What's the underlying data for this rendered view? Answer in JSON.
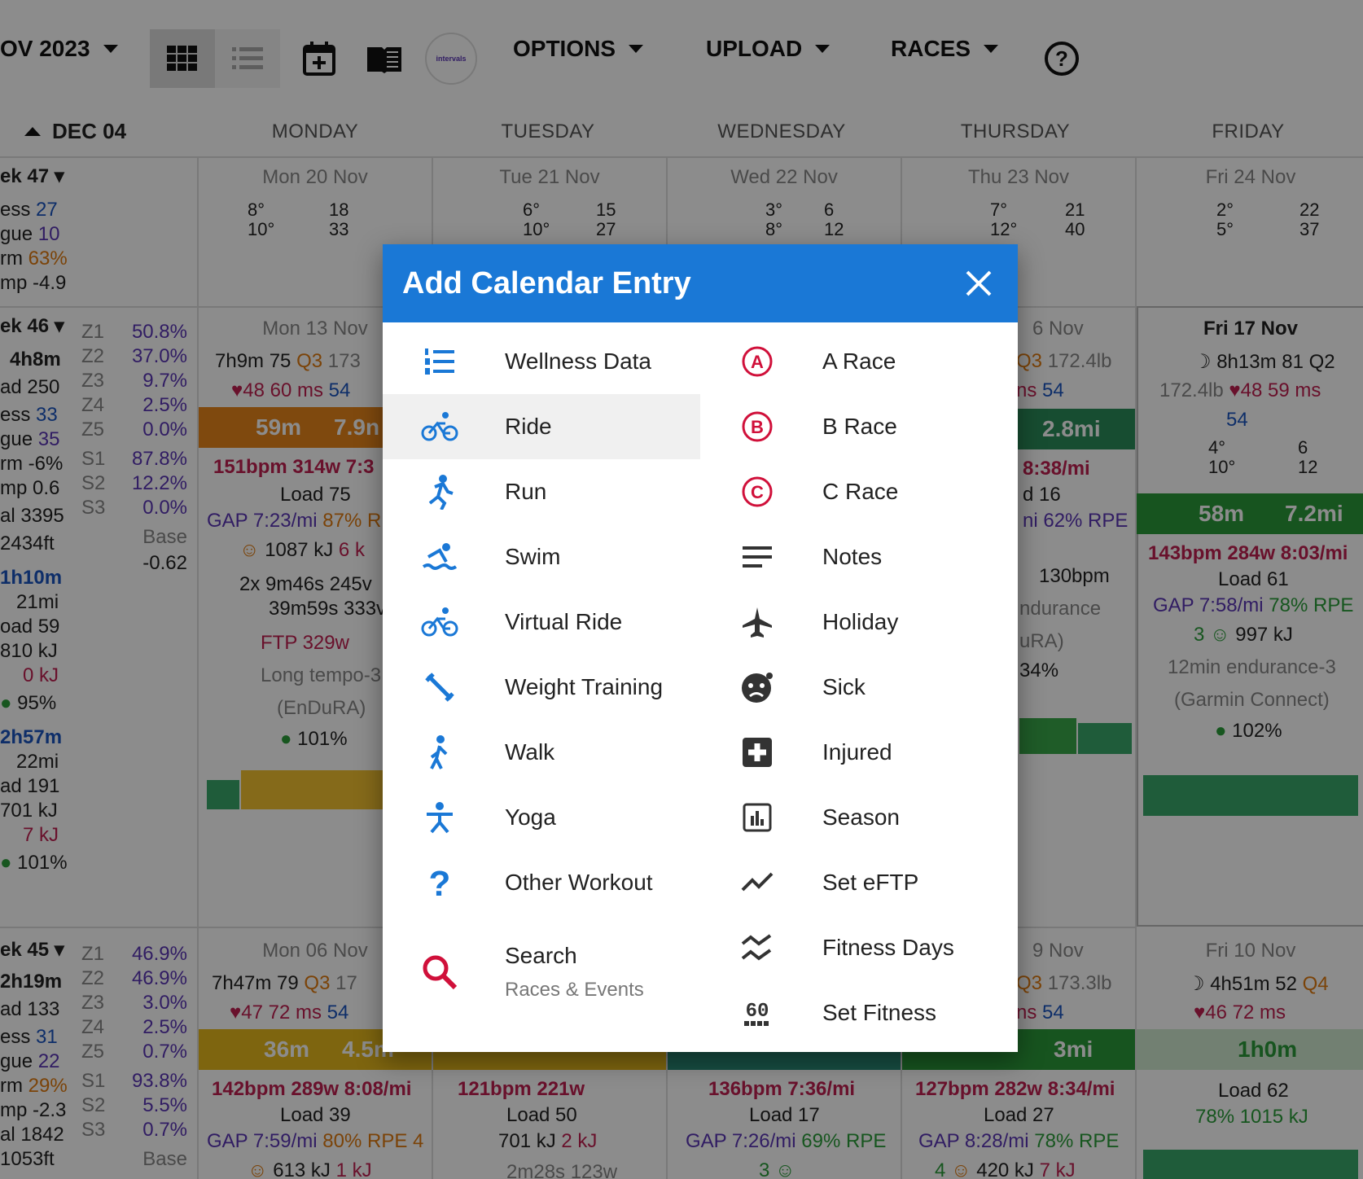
{
  "toolbar": {
    "month": "OV 2023",
    "options": "OPTIONS",
    "upload": "UPLOAD",
    "races": "RACES",
    "logo": "intervals"
  },
  "header": {
    "week_nav": "DEC 04",
    "days": [
      "MONDAY",
      "TUESDAY",
      "WEDNESDAY",
      "THURSDAY",
      "FRIDAY"
    ]
  },
  "left": {
    "w47": {
      "label": "ek 47",
      "fitness": "ess",
      "fitness_v": "27",
      "fatigue": "gue",
      "fatigue_v": "10",
      "form": "rm",
      "form_v": "63%",
      "ramp": "mp -4.9"
    },
    "w46": {
      "label": "ek 46",
      "time": "4h8m",
      "load": "ad 250",
      "fitness": "ess",
      "fitness_v": "33",
      "fatigue": "gue",
      "fatigue_v": "35",
      "form": "rm -6%",
      "ramp": "mp 0.6",
      "cal": "al 3395",
      "elev": "2434ft",
      "t1": "1h10m",
      "d1": "21mi",
      "l1": "oad 59",
      "k1": "810 kJ",
      "k1b": "0 kJ",
      "c1": "95%",
      "t2": "2h57m",
      "d2": "22mi",
      "l2": "ad 191",
      "k2": "701 kJ",
      "k2b": "7 kJ",
      "c2": "101%",
      "zones": [
        "Z1",
        "Z2",
        "Z3",
        "Z4",
        "Z5",
        "S1",
        "S2",
        "S3"
      ],
      "zone_vals": [
        "50.8%",
        "37.0%",
        "9.7%",
        "2.5%",
        "0.0%",
        "87.8%",
        "12.2%",
        "0.0%"
      ],
      "base": "Base",
      "base_v": "-0.62"
    },
    "w45": {
      "label": "ek 45",
      "time": "2h19m",
      "load": "ad 133",
      "fitness": "ess",
      "fitness_v": "31",
      "fatigue": "gue",
      "fatigue_v": "22",
      "form": "rm",
      "form_v": "29%",
      "ramp": "mp -2.3",
      "cal": "al 1842",
      "elev": "1053ft",
      "zones": [
        "Z1",
        "Z2",
        "Z3",
        "Z4",
        "Z5",
        "S1",
        "S2",
        "S3"
      ],
      "zone_vals": [
        "46.9%",
        "46.9%",
        "3.0%",
        "2.5%",
        "0.7%",
        "93.8%",
        "5.5%",
        "0.7%"
      ],
      "base": "Base"
    }
  },
  "cols": {
    "mon": {
      "date1": "Mon 20 Nov",
      "w1a": "8°",
      "w1b": "10°",
      "w1c": "18",
      "w1d": "33",
      "date2": "Mon 13 Nov",
      "sleep": "7h9m 75",
      "q": "Q3",
      "wt": "173",
      "hr": "48 60 ms",
      "hrv": "54",
      "band": "59m",
      "band2": "7.9n",
      "stats": "151bpm 314w  7:3",
      "load": "Load 75",
      "gap": "GAP 7:23/mi",
      "rpe": "87% RI",
      "kj": "1087 kJ",
      "kj2": "6 k",
      "int1": "2x    9m46s 245v",
      "int2": "39m59s 333v",
      "ftp": "FTP 329w",
      "name1": "Long tempo-3",
      "name2": "(EnDuRA)",
      "comp": "101%",
      "date3": "Mon 06 Nov",
      "sleep3": "7h47m 79",
      "q3": "Q3",
      "wt3": "17",
      "hr3": "47 72 ms",
      "hrv3": "54",
      "band3": "36m",
      "band3b": "4.5m",
      "stats3": "142bpm 289w  8:08/mi",
      "load3": "Load 39",
      "gap3": "GAP 7:59/mi",
      "rpe3": "80% RPE 4",
      "kj3": "613 kJ",
      "kj3b": "1 kJ"
    },
    "tue": {
      "date1": "Tue 21 Nov",
      "w1a": "6°",
      "w1b": "10°",
      "w1c": "15",
      "w1d": "27",
      "stats3": "121bpm 221w",
      "load3": "Load 50",
      "kj3": "701 kJ",
      "kj3b": "2 kJ",
      "int3": "2m28s 123w"
    },
    "wed": {
      "date1": "Wed 22 Nov",
      "w1a": "3°",
      "w1b": "8°",
      "w1c": "6",
      "w1d": "12",
      "stats3": "136bpm 7:36/mi",
      "load3": "Load 17",
      "gap3": "GAP 7:26/mi",
      "rpe3": "69% RPE",
      "r3": "3"
    },
    "thu": {
      "date1": "Thu 23 Nov",
      "w1a": "7°",
      "w1b": "12°",
      "w1c": "21",
      "w1d": "40",
      "date2": "6 Nov",
      "q": "Q3",
      "wt": "172.4lb",
      "hr": "ns",
      "hrv": "54",
      "band": "2.8mi",
      "pace": "8:38/mi",
      "l": "d 16",
      "rpe": "ni 62% RPE",
      "bpm": "130bpm",
      "n1": "ndurance",
      "n2": "uRA)",
      "c": "34%",
      "date3": "9 Nov",
      "q3": "Q3",
      "wt3": "173.3lb",
      "hr3": "ns",
      "hrv3": "54",
      "band3": "3mi",
      "stats3": "127bpm 282w  8:34/mi",
      "load3": "Load 27",
      "gap3": "GAP 8:28/mi",
      "rpe3": "78% RPE",
      "r3": "4",
      "kj3": "420 kJ",
      "kj3b": "7 kJ"
    },
    "fri": {
      "date1": "Fri 24 Nov",
      "w1a": "2°",
      "w1b": "5°",
      "w1c": "22",
      "w1d": "37",
      "date2": "Fri 17 Nov",
      "sleep": "8h13m 81 Q2",
      "wt": "172.4lb",
      "hr": "48 59 ms",
      "hrv": "54",
      "w2a": "4°",
      "w2b": "10°",
      "w2c": "6",
      "w2d": "12",
      "band": "58m",
      "band2": "7.2mi",
      "stats": "143bpm 284w  8:03/mi",
      "load": "Load 61",
      "gap": "GAP 7:58/mi",
      "rpe": "78% RPE",
      "r": "3",
      "kj": "997 kJ",
      "name1": "12min endurance-3",
      "name2": "(Garmin Connect)",
      "comp": "102%",
      "date3": "Fri 10 Nov",
      "sleep3": "4h51m 52",
      "q3": "Q4",
      "hr3": "46 72 ms",
      "band3": "1h0m",
      "load3": "Load 62",
      "kj3": "78% 1015 kJ"
    }
  },
  "modal": {
    "title": "Add Calendar Entry",
    "left_items": [
      {
        "label": "Wellness Data",
        "icon": "list-numbered-icon"
      },
      {
        "label": "Ride",
        "icon": "bike-icon"
      },
      {
        "label": "Run",
        "icon": "run-icon"
      },
      {
        "label": "Swim",
        "icon": "swim-icon"
      },
      {
        "label": "Virtual Ride",
        "icon": "bike-icon"
      },
      {
        "label": "Weight Training",
        "icon": "dumbbell-icon"
      },
      {
        "label": "Walk",
        "icon": "walk-icon"
      },
      {
        "label": "Yoga",
        "icon": "yoga-icon"
      },
      {
        "label": "Other Workout",
        "icon": "question-icon"
      }
    ],
    "search": {
      "label": "Search",
      "sub": "Races & Events"
    },
    "right_items": [
      {
        "label": "A Race",
        "icon": "a-race-icon"
      },
      {
        "label": "B Race",
        "icon": "b-race-icon"
      },
      {
        "label": "C Race",
        "icon": "c-race-icon"
      },
      {
        "label": "Notes",
        "icon": "notes-icon"
      },
      {
        "label": "Holiday",
        "icon": "airplane-icon"
      },
      {
        "label": "Sick",
        "icon": "sick-icon"
      },
      {
        "label": "Injured",
        "icon": "first-aid-icon"
      },
      {
        "label": "Season",
        "icon": "chart-box-icon"
      },
      {
        "label": "Set eFTP",
        "icon": "trend-icon"
      },
      {
        "label": "Fitness Days",
        "icon": "chart-line-icon"
      },
      {
        "label": "Set Fitness",
        "icon": "sixty-icon"
      }
    ]
  },
  "colors": {
    "accent": "#1a78d6",
    "run_orange": "#e07b10",
    "run_green": "#2a9d3a",
    "race_red": "#d0103a"
  }
}
